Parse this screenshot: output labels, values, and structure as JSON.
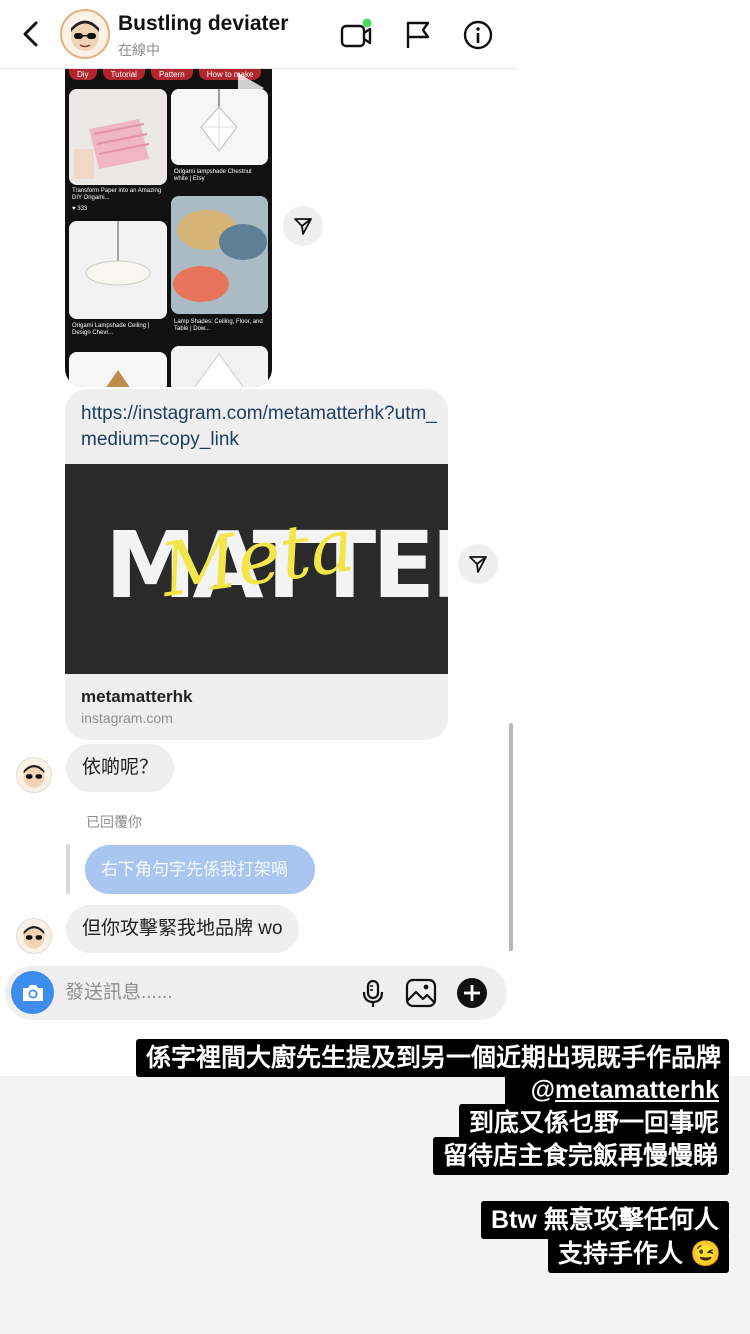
{
  "header": {
    "back_glyph": "‹",
    "name": "Bustling deviater",
    "status": "在線中",
    "icons": [
      "video-call-icon",
      "flag-icon",
      "info-icon"
    ]
  },
  "pinterest": {
    "tabs": [
      "Diy",
      "Tutorial",
      "Pattern",
      "How to make"
    ],
    "pins": [
      {
        "caption": "Transform Paper into an Amazing DIY Origami...",
        "likes": "333"
      },
      {
        "caption": "Origami lampshade Chestnut white | Etsy"
      },
      {
        "caption": "Origami Lampshade Ceiling | Design Chevr..."
      },
      {
        "caption": "Lamp Shades: Ceiling, Floor, and Table | Dow..."
      }
    ]
  },
  "link": {
    "url": "https://instagram.com/metamatterhk?utm_medium=copy_link",
    "image_word": "MATTER",
    "image_script": "Meta",
    "title": "metamatterhk",
    "host": "instagram.com"
  },
  "messages": {
    "m1": "依啲呢？",
    "reply_label": "已回覆你",
    "reply_quote": "右下角句字先係我打架喎",
    "m2": "但你攻擊緊我地品牌 wo"
  },
  "composer": {
    "placeholder": "發送訊息......"
  },
  "captions": {
    "line1": "係字裡間大廚先生提及到另一個近期出現既手作品牌",
    "line2": "@metamatterhk",
    "line3": "到底又係乜野一回事呢",
    "line4": "留待店主食完飯再慢慢睇",
    "line5_prefix": "Btw",
    "line5": "無意攻擊任何人",
    "line6": "支持手作人",
    "line6_emoji": "😉"
  },
  "colors": {
    "accent_blue": "#3d8cf0",
    "reply_bubble": "#a8c6f0",
    "online_dot": "#4cd964",
    "meta_yellow": "#f2e64a"
  }
}
